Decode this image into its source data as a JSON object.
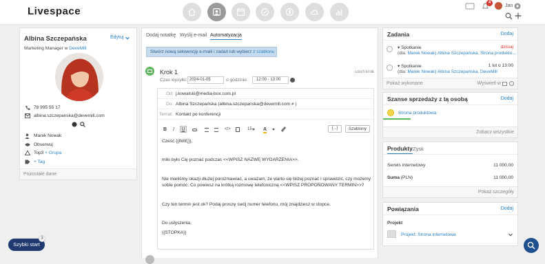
{
  "topbar": {
    "logo": "Livespace",
    "notif_count": "4",
    "user_name": "Jan"
  },
  "profile": {
    "name": "Albina Szczepańska",
    "edit": "Edytuj",
    "role": "Marketing Manager w",
    "company": "DeveMill",
    "phone": "78 995 55 17",
    "email": "albina.szczepanska@devemill.com",
    "owner": "Marek Nowak",
    "observe": "Obserwuj",
    "group_prefix": "Top3",
    "group_link": "+ Grupa",
    "tag_link": "+ Tag",
    "footer": "Pozostałe dane"
  },
  "tabs": {
    "note": "Dodaj notatkę",
    "email": "Wyślij e-mail",
    "automation": "Automatyzacja"
  },
  "sequence_btn": {
    "prefix": "Stwórz nową sekwencję e-maili i zadań lub wybierz",
    "link": "z szablonu"
  },
  "step": {
    "title": "Krok 1",
    "user": "usuń krok",
    "send_label": "Czas wysyłki:",
    "date": "2024-01-05",
    "time_label": "o godzinie:",
    "time": "12:00 - 13:00",
    "from_label": "Od:",
    "from": "j.kowalski@media-box.com.pl",
    "to_label": "Do:",
    "to": "Albina Szczepańska  (albina.szczepanska@devemill.com ≠ )",
    "subject_label": "Temat:",
    "subject": "Kontakt po konferencji",
    "toolbar": {
      "bold": "B",
      "italic": "I",
      "underline": "U",
      "size": "15",
      "more": "{...}",
      "templates": "Szablony"
    },
    "body": [
      "Cześć {{IMIĘ}},",
      "miło było Cię poznać podczas <<WPISZ NAZWĘ WYDARZENIA>>.",
      "Nie mieliśmy okazji dłużej porozmawiać, a uważam, że warto się bliżej poznać i sprawdzić, czy możemy",
      "sobie pomóc. Co powiesz na krótką rozmowę telefoniczną <<WPISZ PROPONOWANY TERMIN>>?",
      "Czy ten termin jest ok? Podaj proszę swój numer telefonu, mój znajdziesz w stopce.",
      "Do usłyszenia,",
      "{{STOPKA}}"
    ]
  },
  "tasks": {
    "title": "Zadania",
    "add": "Dodaj",
    "items": [
      {
        "name": "Spotkanie",
        "date": "dzisiaj",
        "for_label": "(dla:",
        "people": "Marek Nowak) Albina Szczepańska, Strona produkto…"
      },
      {
        "name": "Spotkanie",
        "date": "1 lut o 13:00",
        "for_label": "(dla:",
        "people": "Marek Nowak) Albina Szczepańska, DeveMill"
      }
    ],
    "foot_left": "Pokaż wykonane",
    "foot_right": "Wyświetl w"
  },
  "opps": {
    "title": "Szanse sprzedaży z tą osobą",
    "add": "Dodaj",
    "item": "Strona produktowa",
    "foot": "Zobacz wszystkie"
  },
  "products": {
    "tab1": "Produkty",
    "tab2": "Zysk",
    "row1_label": "Serwis internetowy",
    "row1_value": "11 000,00",
    "row2_label": "Suma",
    "row2_unit": "(PLN)",
    "row2_value": "11 000,00",
    "foot": "Pokaż szczegóły"
  },
  "relations": {
    "title": "Powiązania",
    "add": "Dodaj",
    "section": "Projekt",
    "item": "Projekt: Strona internetowa"
  },
  "quickstart": {
    "label": "Szybki start",
    "badge": "3"
  },
  "colors": {
    "accent": "#2a7fc4",
    "green": "#5cb85c",
    "quickstart": "#1e3a6e"
  }
}
